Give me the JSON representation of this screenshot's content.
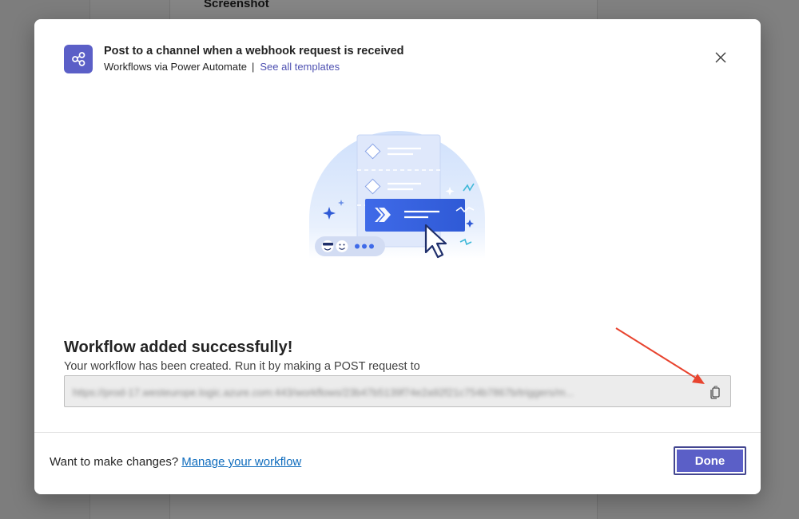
{
  "background": {
    "heading": "Screenshot"
  },
  "dialog": {
    "title": "Post to a channel when a webhook request is received",
    "subtitle_source": "Workflows via Power Automate",
    "separator": "|",
    "see_all_templates_label": "See all templates",
    "close_icon": "close-icon",
    "workflow_icon": "share-nodes-icon"
  },
  "content": {
    "success_title": "Workflow added successfully!",
    "success_description": "Your workflow has been created. Run it by making a POST request to",
    "url_value": "https://prod-17.westeurope.logic.azure.com:443/workflows/23b47b5139f74e2a92f21c754b7867b/triggers/m...",
    "copy_icon": "copy-icon"
  },
  "footer": {
    "prompt": "Want to make changes?",
    "manage_link_label": "Manage your workflow",
    "done_label": "Done"
  },
  "colors": {
    "brand": "#5b5fc7",
    "link": "#0f6cbd",
    "annotation_arrow": "#e8442f"
  }
}
